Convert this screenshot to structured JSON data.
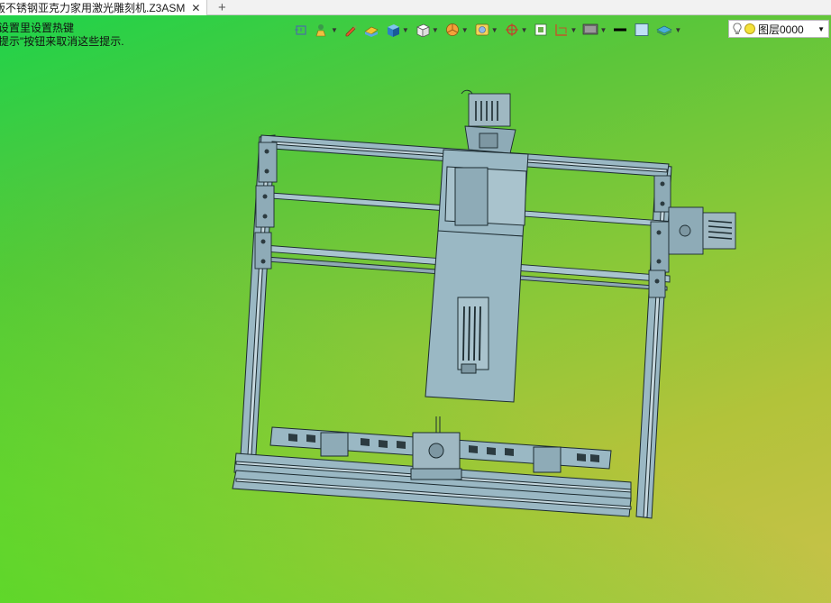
{
  "tab": {
    "title": "版不锈钢亚克力家用激光雕刻机.Z3ASM",
    "close_glyph": "✕",
    "add_glyph": "+"
  },
  "hint": {
    "line1": "设置里设置热键",
    "line2": "提示\"按钮来取消这些提示."
  },
  "toolbar": {
    "items": [
      "frame-icon",
      "light-icon",
      "pencil-icon",
      "render-mode-icon",
      "solid-box-icon",
      "cube-view-icon",
      "pie-icon",
      "display-icon",
      "axis-target-icon",
      "grid-icon",
      "dimension-icon",
      "screen-icon",
      "line-icon",
      "color-swatch-icon",
      "layer-icon"
    ]
  },
  "layer": {
    "name": "图层0000",
    "dot_color": "#f4e23a"
  },
  "colors": {
    "part_fill": "#9ab8c4",
    "part_stroke": "#1c2b30",
    "bg_start": "#1fd34a",
    "bg_end": "#c9c14a"
  }
}
